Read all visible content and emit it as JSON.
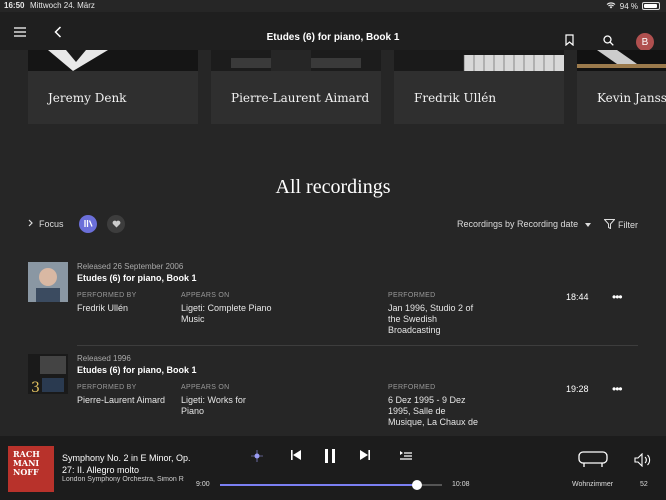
{
  "status": {
    "time": "16:50",
    "date": "Mittwoch 24. März",
    "battery": "94 %",
    "battery_level": 0.94
  },
  "nav": {
    "title": "Etudes (6) for piano, Book 1",
    "avatar": "B"
  },
  "performers": [
    {
      "name": "Jeremy Denk"
    },
    {
      "name": "Pierre-Laurent Aimard"
    },
    {
      "name": "Fredrik Ullén"
    },
    {
      "name": "Kevin Jansso"
    }
  ],
  "section": {
    "heading": "All recordings"
  },
  "toolbar": {
    "focus_label": "Focus",
    "sort_label": "Recordings by Recording date",
    "filter_label": "Filter"
  },
  "labels": {
    "performed_by": "PERFORMED BY",
    "appears_on": "APPEARS ON",
    "performed": "PERFORMED"
  },
  "recordings": [
    {
      "released": "Released 26 September 2006",
      "work": "Etudes (6) for piano, Book 1",
      "performer": "Fredrik Ullén",
      "album": [
        "Ligeti: Complete Piano",
        "Music"
      ],
      "performed": [
        "Jan 1996, Studio 2 of",
        "the Swedish",
        "Broadcasting"
      ],
      "duration": "18:44",
      "more": "•••"
    },
    {
      "released": "Released 1996",
      "work": "Etudes (6) for piano, Book 1",
      "performer": "Pierre-Laurent Aimard",
      "album": [
        "Ligeti: Works for",
        "Piano"
      ],
      "performed": [
        "6 Dez 1995 - 9 Dez",
        "1995, Salle de",
        "Musique, La Chaux de"
      ],
      "duration": "19:28",
      "more": "•••"
    }
  ],
  "player": {
    "cover_text": [
      "RACH",
      "MANI",
      "NOFF"
    ],
    "track": "Symphony No. 2 in E Minor, Op. 27: II. Allegro molto",
    "artist": "London Symphony Orchestra, Simon R",
    "elapsed": "9:00",
    "total": "10:08",
    "progress": 0.888,
    "room": "Wohnzimmer",
    "volume": "52"
  },
  "colors": {
    "accent": "#7b7ff2",
    "background": "#262626",
    "card": "#2f2f2f",
    "avatar": "#b0504f"
  }
}
